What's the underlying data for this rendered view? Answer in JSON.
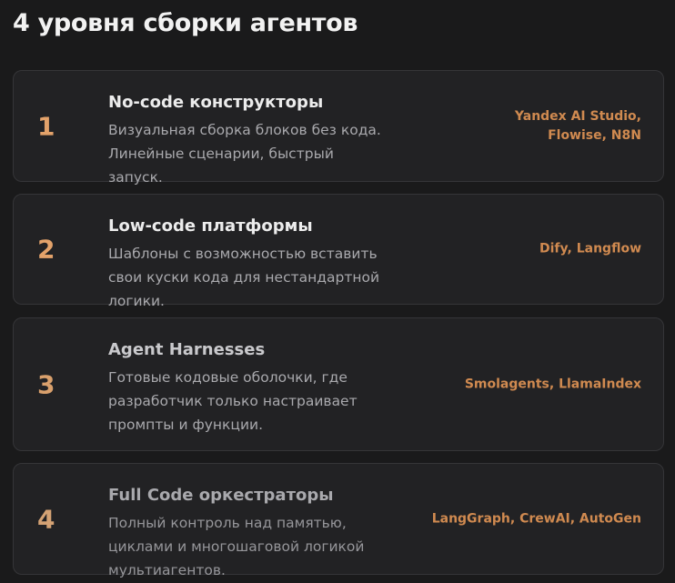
{
  "page": {
    "title": "4 уровня сборки агентов"
  },
  "levels": [
    {
      "number": "1",
      "title": "No-code конструкторы",
      "description": "Визуальная сборка блоков без кода. Линейные сценарии, быстрый запуск.",
      "tools": "Yandex AI Studio,\nFlowise, N8N"
    },
    {
      "number": "2",
      "title": "Low-code платформы",
      "description": "Шаблоны с возможностью вставить свои куски кода для нестандартной логики.",
      "tools": "Dify, Langflow"
    },
    {
      "number": "3",
      "title": "Agent Harnesses",
      "description": "Готовые кодовые оболочки, где разработчик только настраивает промпты и функции.",
      "tools": "Smolagents, LlamaIndex"
    },
    {
      "number": "4",
      "title": "Full Code оркестраторы",
      "description": "Полный контроль над памятью, циклами и многошаговой логикой мультиагентов.",
      "tools": "LangGraph, CrewAI, AutoGen"
    }
  ],
  "colors": {
    "background": "#1a1a1b",
    "card": "#222224",
    "accent": "#e3a26a",
    "tools": "#d08a50"
  }
}
